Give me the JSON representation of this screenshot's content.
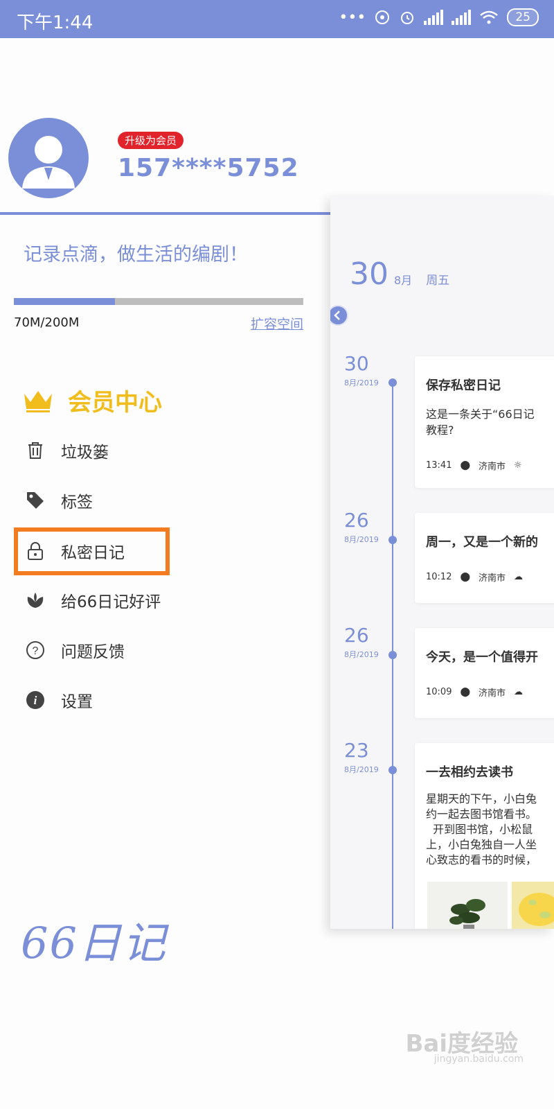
{
  "status_bar": {
    "time": "下午1:44",
    "battery": "25"
  },
  "profile": {
    "badge": "升级为会员",
    "phone": "157****5752",
    "slogan": "记录点滴，做生活的编剧！"
  },
  "storage": {
    "used_text": "70M/200M",
    "used_fraction": 0.35,
    "expand_label": "扩容空间"
  },
  "menu": {
    "vip_label": "会员中心",
    "items": [
      {
        "label": "垃圾篓",
        "icon": "trash-icon"
      },
      {
        "label": "标签",
        "icon": "tag-icon"
      },
      {
        "label": "私密日记",
        "icon": "lock-icon"
      },
      {
        "label": "给66日记好评",
        "icon": "flower-icon"
      },
      {
        "label": "问题反馈",
        "icon": "question-icon"
      },
      {
        "label": "设置",
        "icon": "info-icon"
      }
    ]
  },
  "logo": "66日记",
  "panel": {
    "header": {
      "day": "30",
      "month": "8月",
      "weekday": "周五"
    },
    "entries": [
      {
        "day": "30",
        "month": "8月",
        "year": "2019",
        "title": "保存私密日记",
        "body": "这是一条关于“66日记\n教程?",
        "time": "13:41",
        "location": "济南市",
        "weather": "sun-icon"
      },
      {
        "day": "26",
        "month": "8月",
        "year": "2019",
        "title": "周一，又是一个新的",
        "body": "",
        "time": "10:12",
        "location": "济南市",
        "weather": "cloud-icon"
      },
      {
        "day": "26",
        "month": "8月",
        "year": "2019",
        "title": "今天，是一个值得开",
        "body": "",
        "time": "10:09",
        "location": "济南市",
        "weather": "cloud-icon"
      },
      {
        "day": "23",
        "month": "8月",
        "year": "2019",
        "title": "一去相约去读书",
        "body": "星期天的下午，小白兔\n约一起去图书馆看书。\n  开到图书馆，小松鼠\n上，小白兔独自一人坐\n心致志的看书的时候，",
        "time": "",
        "location": "",
        "weather": ""
      }
    ]
  },
  "watermark": "Bai度经验",
  "watermark_sub": "jingyan.baidu.com",
  "colors": {
    "accent": "#7b8fd8",
    "badge": "#e1242b",
    "vip": "#f0bd1c",
    "highlight": "#f47c20"
  }
}
